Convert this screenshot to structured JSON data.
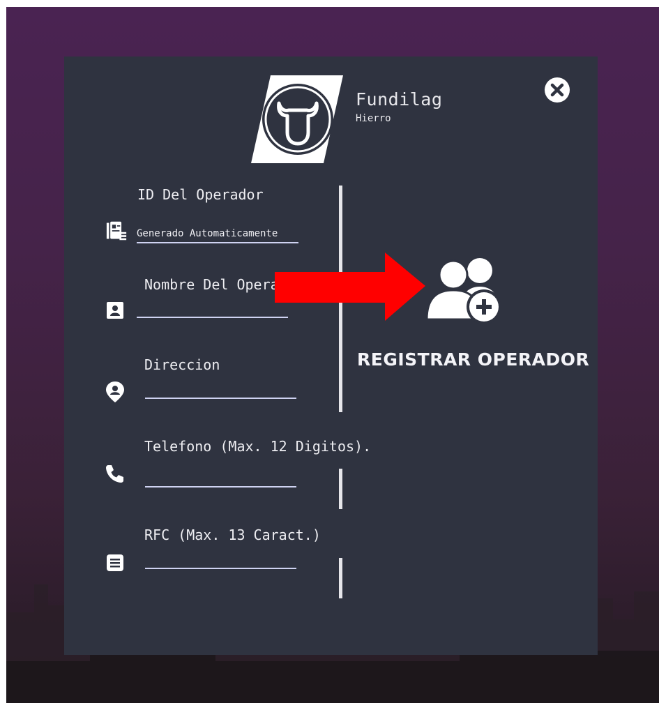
{
  "colors": {
    "background_top": "#4a2352",
    "panel": "#2f3340",
    "text": "#eeeef2",
    "input_underline": "#cfd3f2",
    "annotation_arrow": "#ff0000"
  },
  "header": {
    "company_name": "Fundilag",
    "company_subtitle": "Hierro",
    "logo_icon": "bull-head-icon",
    "close_icon": "close-icon"
  },
  "form": {
    "fields": [
      {
        "label": "ID Del Operador",
        "icon": "id-card-icon",
        "value": "Generado Automaticamente"
      },
      {
        "label": "Nombre Del Operador",
        "icon": "contact-icon",
        "value": ""
      },
      {
        "label": "Direccion",
        "icon": "location-pin-icon",
        "value": ""
      },
      {
        "label": "Telefono (Max. 12 Digitos).",
        "icon": "phone-icon",
        "value": ""
      },
      {
        "label": "RFC (Max. 13 Caract.)",
        "icon": "document-icon",
        "value": ""
      }
    ]
  },
  "action": {
    "label": "REGISTRAR OPERADOR",
    "icon": "add-users-icon"
  },
  "annotation": {
    "arrow_icon": "red-arrow-icon"
  }
}
